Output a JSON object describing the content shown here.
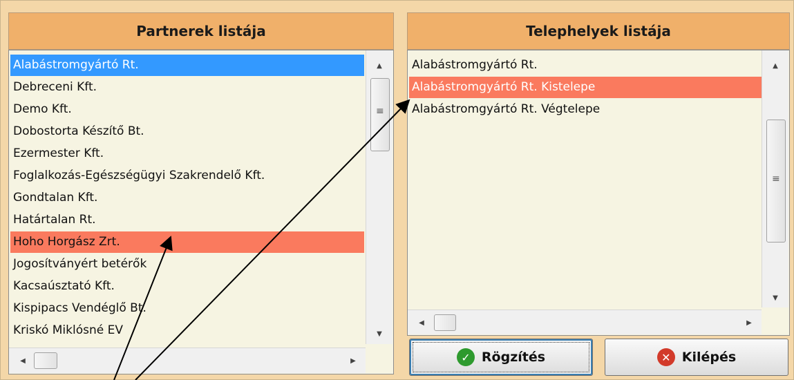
{
  "partners": {
    "title": "Partnerek listája",
    "items": [
      "Alabástromgyártó Rt.",
      "Debreceni Kft.",
      "Demo Kft.",
      "Dobostorta Készítő Bt.",
      "Ezermester Kft.",
      "Foglalkozás-Egészségügyi Szakrendelő Kft.",
      "Gondtalan Kft.",
      "Határtalan Rt.",
      "Hoho Horgász Zrt.",
      "Jogosítványért betérők",
      "Kacsaúsztató Kft.",
      "Kispipacs Vendéglő Bt.",
      "Kriskó Miklósné EV"
    ],
    "focused_index": 0,
    "selected_index": 8
  },
  "sites": {
    "title": "Telephelyek listája",
    "items": [
      "Alabástromgyártó Rt.",
      "Alabástromgyártó Rt. Kistelepe",
      "Alabástromgyártó Rt. Végtelepe"
    ],
    "selected_index": 1
  },
  "buttons": {
    "save": "Rögzítés",
    "exit": "Kilépés"
  },
  "icons": {
    "save": "check-icon",
    "exit": "close-icon"
  },
  "colors": {
    "panel_bg": "#f4d7a8",
    "header_bg": "#f0b06a",
    "list_bg": "#f6f4e2",
    "selection_red": "#fa7a5e",
    "focus_blue": "#3399ff"
  }
}
